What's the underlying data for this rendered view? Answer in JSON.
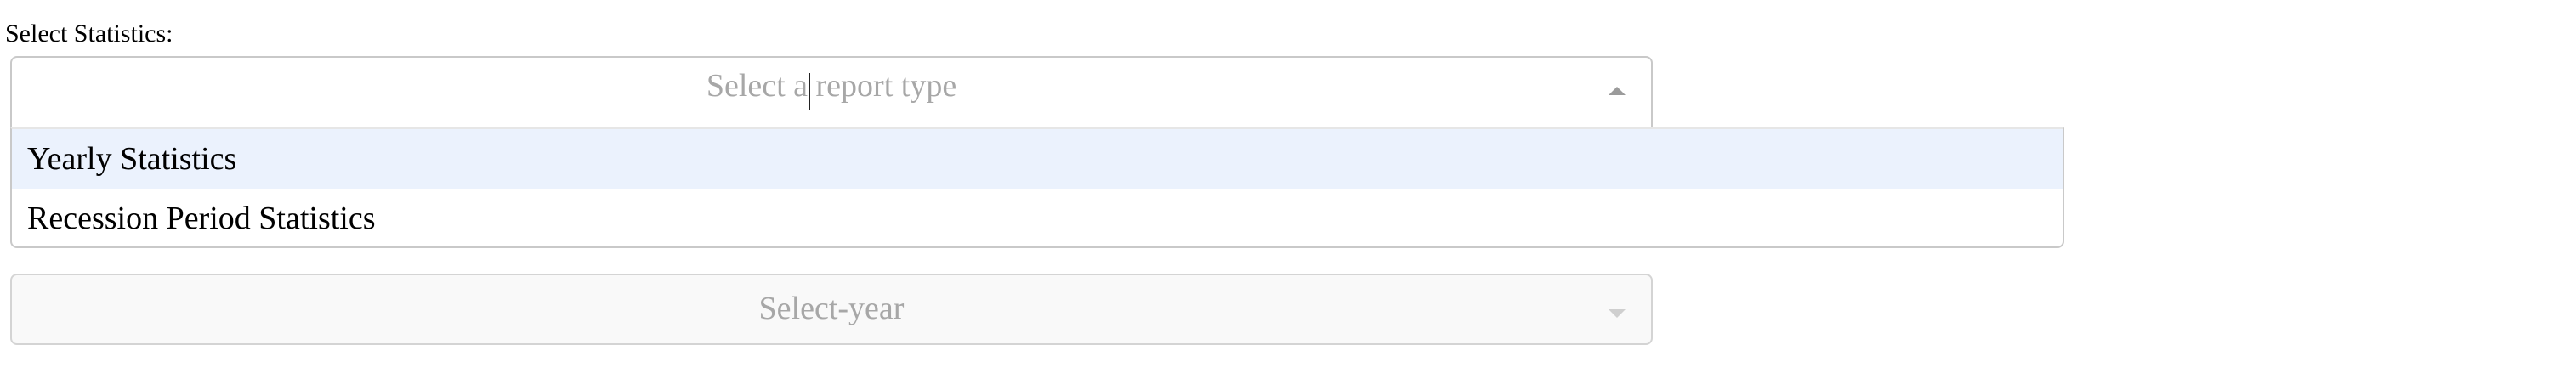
{
  "form": {
    "label": "Select Statistics:",
    "report_select": {
      "placeholder": "Select a report type",
      "options": [
        {
          "label": "Yearly Statistics",
          "focused": true
        },
        {
          "label": "Recession Period Statistics",
          "focused": false
        }
      ]
    },
    "year_select": {
      "placeholder": "Select-year",
      "disabled": true
    }
  },
  "icons": {
    "report_arrow": "chevron-up-icon",
    "year_arrow": "chevron-down-icon"
  },
  "colors": {
    "placeholder": "#a7a7a7",
    "border": "#c9c9c9",
    "focused_option_bg": "#ebf2fd",
    "disabled_bg": "#f9f9f9"
  }
}
